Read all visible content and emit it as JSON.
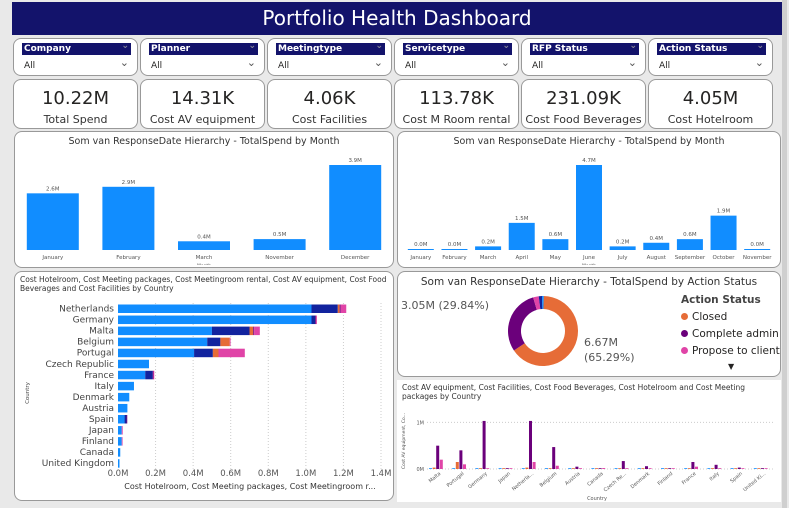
{
  "title": "Portfolio Health Dashboard",
  "filters": [
    {
      "label": "Company",
      "value": "All"
    },
    {
      "label": "Planner",
      "value": "All"
    },
    {
      "label": "Meetingtype",
      "value": "All"
    },
    {
      "label": "Servicetype",
      "value": "All"
    },
    {
      "label": "RFP Status",
      "value": "All"
    },
    {
      "label": "Action Status",
      "value": "All"
    }
  ],
  "kpis": [
    {
      "value": "10.22M",
      "label": "Total Spend"
    },
    {
      "value": "14.31K",
      "label": "Cost AV equipment"
    },
    {
      "value": "4.06K",
      "label": "Cost Facilities"
    },
    {
      "value": "113.78K",
      "label": "Cost M   Room rental"
    },
    {
      "value": "231.09K",
      "label": "Cost Food Beverages"
    },
    {
      "value": "4.05M",
      "label": "Cost Hotelroom"
    }
  ],
  "colors": {
    "blue": "#118dff",
    "navy": "#12239e",
    "orange": "#e66c37",
    "purple": "#6b007b",
    "pink": "#e044a7",
    "title_bar": "#13136b"
  },
  "chart_data": [
    {
      "type": "bar",
      "title": "Som van ResponseDate Hierarchy - TotalSpend by Month",
      "xlabel": "Month",
      "categories": [
        "January",
        "February",
        "March",
        "November",
        "December"
      ],
      "values": [
        2.6,
        2.9,
        0.4,
        0.5,
        3.9
      ],
      "labels": [
        "2.6M",
        "2.9M",
        "0.4M",
        "0.5M",
        "3.9M"
      ]
    },
    {
      "type": "bar",
      "title": "Som van ResponseDate Hierarchy - TotalSpend by Month",
      "xlabel": "Month",
      "categories": [
        "January",
        "February",
        "March",
        "April",
        "May",
        "June",
        "July",
        "August",
        "September",
        "October",
        "November"
      ],
      "values": [
        0.0,
        0.0,
        0.2,
        1.5,
        0.6,
        4.7,
        0.2,
        0.4,
        0.6,
        1.9,
        0.0
      ],
      "labels": [
        "0.0M",
        "0.0M",
        "0.2M",
        "1.5M",
        "0.6M",
        "4.7M",
        "0.2M",
        "0.4M",
        "0.6M",
        "1.9M",
        "0.0M"
      ]
    },
    {
      "type": "bar",
      "orientation": "horizontal",
      "stacked": true,
      "title": "Cost Hotelroom, Cost Meeting packages, Cost Meetingroom rental, Cost AV equipment, Cost Food Beverages and Cost Facilities by Country",
      "xlabel": "Cost Hotelroom, Cost Meeting packages, Cost Meetingroom r...",
      "ylabel": "Country",
      "xlim": [
        0,
        1.4
      ],
      "xticks": [
        "0.0M",
        "0.2M",
        "0.4M",
        "0.6M",
        "0.8M",
        "1.0M",
        "1.2M",
        "1.4M"
      ],
      "categories": [
        "Netherlands",
        "Germany",
        "Malta",
        "Belgium",
        "Portugal",
        "Czech Republic",
        "France",
        "Italy",
        "Denmark",
        "Austria",
        "Spain",
        "Japan",
        "Finland",
        "Canada",
        "United Kingdom"
      ],
      "series": [
        {
          "color": "#118dff",
          "values": [
            1.03,
            1.03,
            0.5,
            0.475,
            0.405,
            0.165,
            0.145,
            0.085,
            0.06,
            0.05,
            0.035,
            0.02,
            0.02,
            0.012,
            0.008
          ]
        },
        {
          "color": "#12239e",
          "values": [
            0.14,
            0.02,
            0.2,
            0.07,
            0.1,
            0,
            0.04,
            0,
            0,
            0,
            0.01,
            0,
            0,
            0,
            0
          ]
        },
        {
          "color": "#e66c37",
          "values": [
            0.01,
            0,
            0.02,
            0.05,
            0.03,
            0,
            0,
            0,
            0,
            0,
            0,
            0,
            0,
            0,
            0
          ]
        },
        {
          "color": "#6b007b",
          "values": [
            0.005,
            0.005,
            0.005,
            0,
            0,
            0,
            0.003,
            0,
            0,
            0,
            0.003,
            0,
            0,
            0,
            0
          ]
        },
        {
          "color": "#e044a7",
          "values": [
            0.03,
            0.003,
            0.03,
            0.003,
            0.14,
            0,
            0.005,
            0,
            0,
            0,
            0,
            0.005,
            0.003,
            0,
            0
          ]
        }
      ]
    },
    {
      "type": "pie",
      "donut": true,
      "title": "Som van ResponseDate Hierarchy - TotalSpend by Action Status",
      "legend_title": "Action Status",
      "legend": "right",
      "slices": [
        {
          "name": "Closed",
          "value": 65.29,
          "color": "#e66c37",
          "label": "6.67M (65.29%)"
        },
        {
          "name": "Complete admin",
          "value": 29.84,
          "color": "#6b007b",
          "label": "3.05M (29.84%)"
        },
        {
          "name": "Propose to client",
          "value": 2.6,
          "color": "#e044a7"
        },
        {
          "value": 1.5,
          "color": "#12239e"
        },
        {
          "value": 0.77,
          "color": "#118dff"
        }
      ]
    },
    {
      "type": "bar",
      "grouped": true,
      "title": "Cost AV equipment, Cost Facilities, Cost Food Beverages, Cost Hotelroom and Cost Meeting packages by Country",
      "xlabel": "Country",
      "ylabel": "Cost AV equipment, Co...",
      "yticks": [
        "0M",
        "1M"
      ],
      "ylim": [
        0,
        1.2
      ],
      "categories": [
        "Malta",
        "Portugal",
        "Germany",
        "Japan",
        "Netherla...",
        "Belgium",
        "Austria",
        "Canada",
        "Czech Re...",
        "Denmark",
        "Finland",
        "France",
        "Italy",
        "Spain",
        "United Ki..."
      ],
      "series": [
        {
          "color": "#118dff",
          "values": [
            0.005,
            0.005,
            0.005,
            0.005,
            0.01,
            0.005,
            0,
            0,
            0,
            0,
            0,
            0.005,
            0,
            0,
            0
          ]
        },
        {
          "color": "#e66c37",
          "values": [
            0.03,
            0.15,
            0.005,
            0.005,
            0.03,
            0.005,
            0,
            0,
            0,
            0,
            0.01,
            0,
            0,
            0,
            0
          ]
        },
        {
          "color": "#6b007b",
          "values": [
            0.5,
            0.4,
            1.03,
            0.01,
            1.03,
            0.47,
            0.05,
            0,
            0.17,
            0.06,
            0.01,
            0.15,
            0.09,
            0.03,
            0.01
          ]
        },
        {
          "color": "#e044a7",
          "values": [
            0.2,
            0.1,
            0.01,
            0,
            0.15,
            0.07,
            0,
            0.02,
            0,
            0,
            0,
            0.05,
            0,
            0.01,
            0.01
          ]
        }
      ]
    }
  ]
}
